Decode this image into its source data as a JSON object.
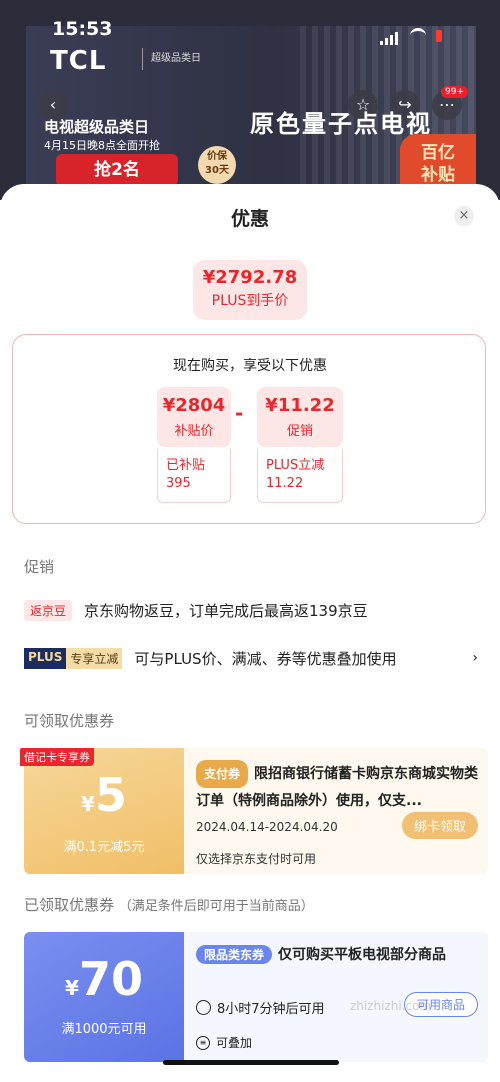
{
  "status_bar": {
    "time": "15:53"
  },
  "banner": {
    "brand": "TCL",
    "sub_brand": "超级品类日",
    "back": "‹",
    "badge": "99+",
    "promo_title": "电视超级品类日",
    "promo_date": "4月15日晚8点全面开抢",
    "grab_button": "抢2名",
    "price_protect": "价保\n30天",
    "headline": "原色量子点电视",
    "subsidy": "百亿\n补贴"
  },
  "sheet": {
    "title": "优惠",
    "close": "×",
    "final_price": "¥2792.78",
    "final_label": "PLUS到手价",
    "calc_title": "现在购买，享受以下优惠",
    "box1_value": "¥2804",
    "box1_label": "补贴价",
    "minus": "-",
    "box2_value": "¥11.22",
    "box2_label": "促销",
    "detail1_line1": "已补贴",
    "detail1_line2": "395",
    "detail2_line1": "PLUS立减",
    "detail2_line2": "11.22"
  },
  "promotions": {
    "header": "促销",
    "item1_tag": "返京豆",
    "item1_text": "京东购物返豆，订单完成后最高返139京豆",
    "item2_tag_a": "PLUS",
    "item2_tag_b": "专享立减",
    "item2_text": "可与PLUS价、满减、券等优惠叠加使用",
    "chevron": "›"
  },
  "available_coupons": {
    "header": "可领取优惠券",
    "coupon": {
      "tag": "借记卡专享券",
      "currency": "¥",
      "amount": "5",
      "condition": "满0.1元减5元",
      "type": "支付券",
      "desc": "限招商银行储蓄卡购京东商城实物类订单（特例商品除外）使用，仅支...",
      "date": "2024.04.14-2024.04.20",
      "button": "绑卡领取",
      "note": "仅选择京东支付时可用"
    }
  },
  "received_coupons": {
    "header": "已领取优惠券",
    "header_note": "（满足条件后即可用于当前商品）",
    "coupon": {
      "currency": "¥",
      "amount": "70",
      "condition": "满1000元可用",
      "type": "限品类东券",
      "desc": "仅可购买平板电视部分商品",
      "timer": "8小时7分钟后可用",
      "button": "可用商品",
      "stack": "可叠加"
    }
  },
  "watermark": "zhizhizhi.com"
}
